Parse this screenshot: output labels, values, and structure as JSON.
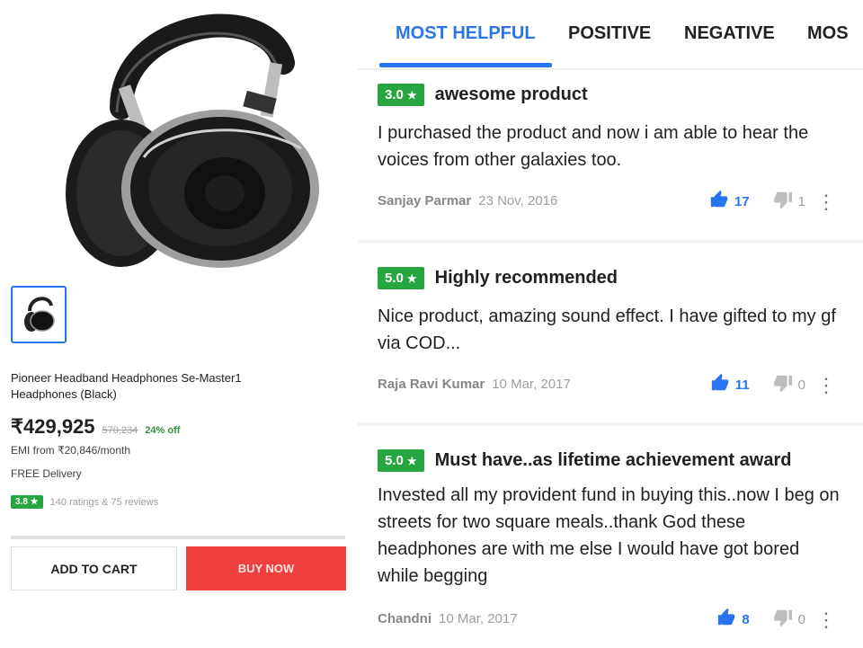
{
  "product": {
    "title": "Pioneer Headband Headphones Se-Master1 Headphones (Black)",
    "price": "₹429,925",
    "mrp": "570,234",
    "discount": "24% off",
    "emi": "EMI from ₹20,846/month",
    "delivery": "FREE Delivery",
    "rating": "3.8 ★",
    "rating_count": "140 ratings & 75 reviews",
    "hero_image": "headphones-image",
    "thumbnail": "headphones-thumbnail"
  },
  "actions": {
    "add_to_cart": "ADD TO CART",
    "buy_now": "BUY NOW"
  },
  "tabs": [
    {
      "label": "MOST HELPFUL",
      "active": true
    },
    {
      "label": "POSITIVE",
      "active": false
    },
    {
      "label": "NEGATIVE",
      "active": false
    },
    {
      "label": "MOS",
      "active": false
    }
  ],
  "reviews": [
    {
      "rating": "3.0",
      "title": "awesome product",
      "body": "I purchased the product and now i am able to hear the voices from other galaxies too.",
      "author": "Sanjay Parmar",
      "date": "23 Nov, 2016",
      "likes": "17",
      "dislikes": "1"
    },
    {
      "rating": "5.0",
      "title": "Highly recommended",
      "body": "Nice product, amazing sound effect. I have gifted to my gf via COD...",
      "author": "Raja Ravi Kumar",
      "date": "10 Mar, 2017",
      "likes": "11",
      "dislikes": "0"
    },
    {
      "rating": "5.0",
      "title": "Must have..as lifetime achievement award",
      "body": "Invested all my provident fund in buying this..now I beg on streets for two square meals..thank God these headphones are with me else I would have got bored while begging",
      "author": "Chandni",
      "date": "10 Mar, 2017",
      "likes": "8",
      "dislikes": "0"
    }
  ],
  "colors": {
    "accent": "#2874f0",
    "rating_green": "#26a541",
    "buy_red": "#ef3f3e"
  },
  "icons": {
    "star": "★",
    "like": "thumbs-up-icon",
    "dislike": "thumbs-down-icon",
    "more": "more-vertical-icon"
  }
}
